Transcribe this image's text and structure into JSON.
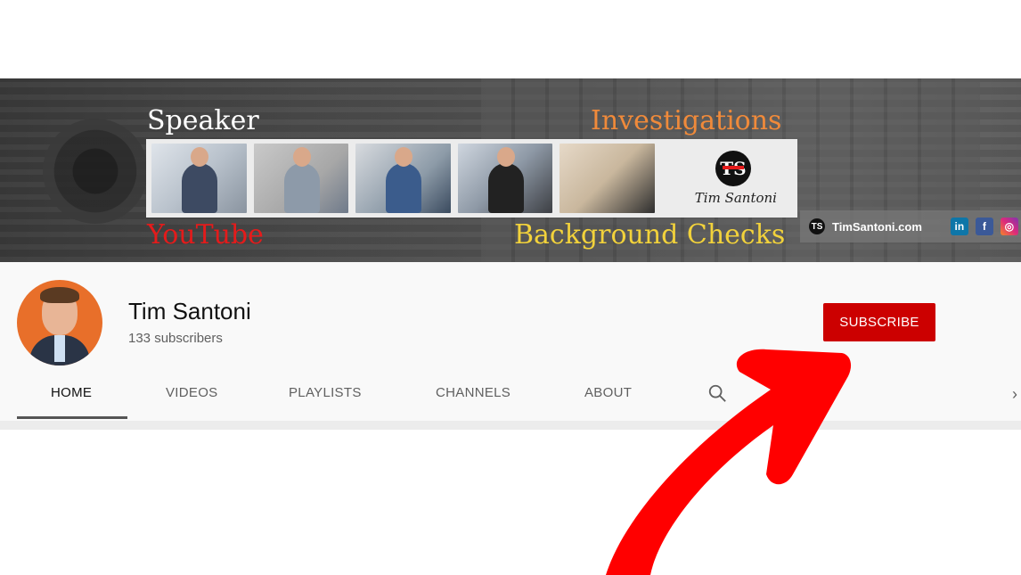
{
  "banner": {
    "titles": {
      "speaker": "Speaker",
      "investigations": "Investigations",
      "youtube": "YouTube",
      "background_checks": "Background Checks"
    },
    "logo_name": "Tim Santoni",
    "website": "TimSantoni.com",
    "social": {
      "linkedin": "in",
      "facebook": "f",
      "instagram": "◎"
    }
  },
  "channel": {
    "name": "Tim Santoni",
    "subscribers": "133 subscribers",
    "subscribe_label": "SUBSCRIBE"
  },
  "tabs": [
    "HOME",
    "VIDEOS",
    "PLAYLISTS",
    "CHANNELS",
    "ABOUT"
  ],
  "colors": {
    "subscribe": "#cc0000",
    "arrow": "#ff0000"
  }
}
